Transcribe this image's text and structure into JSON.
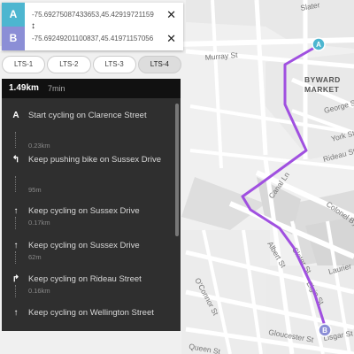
{
  "waypoints": {
    "a": {
      "letter": "A",
      "value": "-75.69275087433653,45.42919721159",
      "clear": "✕"
    },
    "b": {
      "letter": "B",
      "value": "-75.69249201100837,45.41971157056",
      "clear": "✕"
    },
    "swap_icon": "↕"
  },
  "lts_tabs": [
    {
      "label": "LTS-1",
      "active": false
    },
    {
      "label": "LTS-2",
      "active": false
    },
    {
      "label": "LTS-3",
      "active": false
    },
    {
      "label": "LTS-4",
      "active": true
    }
  ],
  "summary": {
    "distance": "1.49km",
    "time": "7min"
  },
  "steps": [
    {
      "icon": "A",
      "text": "Start cycling on Clarence Street",
      "distance": "0.23km"
    },
    {
      "icon": "↰",
      "text": "Keep pushing bike on Sussex Drive",
      "distance": "95m"
    },
    {
      "icon": "↑",
      "text": "Keep cycling on Sussex Drive",
      "distance": "0.17km"
    },
    {
      "icon": "↑",
      "text": "Keep cycling on Sussex Drive",
      "distance": "62m"
    },
    {
      "icon": "↱",
      "text": "Keep cycling on Rideau Street",
      "distance": "0.16km"
    },
    {
      "icon": "↑",
      "text": "Keep cycling on Wellington Street",
      "distance": ""
    }
  ],
  "map": {
    "route_color": "#a050e0",
    "labels": {
      "murray": "Murray St",
      "byward": "BYWARD",
      "market": "MARKET",
      "george": "George St",
      "york": "York St",
      "rideau": "Rideau St",
      "canal": "Canal Ln",
      "colonel": "Colonel By",
      "albert": "Albert St",
      "oconnor": "O'Connor St",
      "laurier": "Laurier",
      "queen": "Queen St",
      "gloucester": "Gloucester St",
      "lisgar": "Lisgar St",
      "slater": "Slater St",
      "slater2": "Slater",
      "elgin": "Elgin St"
    },
    "markers": {
      "start": "A",
      "end": "B"
    }
  }
}
